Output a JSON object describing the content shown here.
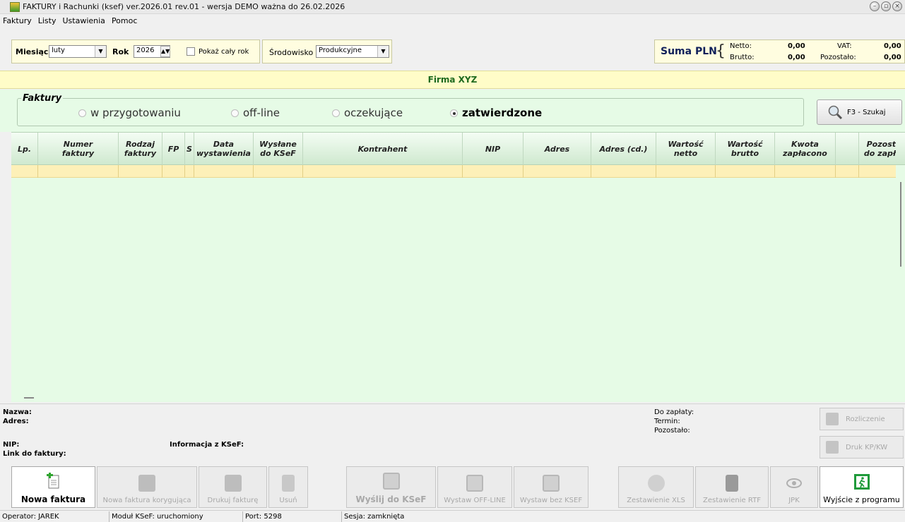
{
  "window": {
    "title": "FAKTURY i Rachunki (ksef) ver.2026.01 rev.01 - wersja DEMO ważna do 26.02.2026"
  },
  "menu": [
    "Faktury",
    "Listy",
    "Ustawienia",
    "Pomoc"
  ],
  "filters": {
    "month_label": "Miesiąc",
    "month_value": "luty",
    "year_label": "Rok",
    "year_value": "2026",
    "show_year_label": "Pokaż cały rok",
    "env_label": "Środowisko",
    "env_value": "Produkcyjne"
  },
  "summary": {
    "title": "Suma PLN",
    "netto_label": "Netto:",
    "netto_value": "0,00",
    "brutto_label": "Brutto:",
    "brutto_value": "0,00",
    "vat_label": "VAT:",
    "vat_value": "0,00",
    "remaining_label": "Pozostało:",
    "remaining_value": "0,00"
  },
  "firm": "Firma XYZ",
  "invoices_group": {
    "title": "Faktury",
    "options": [
      "w przygotowaniu",
      "off-line",
      "oczekujące",
      "zatwierdzone"
    ],
    "selected": "zatwierdzone"
  },
  "search_button": "F3 - Szukaj",
  "table": {
    "columns": [
      [
        "Lp."
      ],
      [
        "Numer",
        "faktury"
      ],
      [
        "Rodzaj",
        "faktury"
      ],
      [
        "FP"
      ],
      [
        "S"
      ],
      [
        "Data",
        "wystawienia"
      ],
      [
        "Wysłane",
        "do KSeF"
      ],
      [
        "Kontrahent"
      ],
      [
        "NIP"
      ],
      [
        "Adres"
      ],
      [
        "Adres (cd.)"
      ],
      [
        "Wartość",
        "netto"
      ],
      [
        "Wartość",
        "brutto"
      ],
      [
        "Kwota",
        "zapłacono"
      ],
      [
        ""
      ],
      [
        "Pozost",
        "do zapł"
      ]
    ]
  },
  "details": {
    "name_label": "Nazwa:",
    "address_label": "Adres:",
    "nip_label": "NIP:",
    "link_label": "Link do faktury:",
    "ksef_info_label": "Informacja z KSeF:",
    "to_pay_label": "Do zapłaty:",
    "term_label": "Termin:",
    "remaining_label": "Pozostało:",
    "settlement_button": "Rozliczenie",
    "print_kp_button": "Druk KP/KW"
  },
  "buttons": {
    "new_invoice": "Nowa faktura",
    "new_correction": "Nowa faktura korygująca",
    "print_invoice": "Drukuj fakturę",
    "delete": "Usuń",
    "send_ksef": "Wyślij do KSeF",
    "issue_offline": "Wystaw OFF-LINE",
    "issue_no_ksef": "Wystaw bez KSEF",
    "report_xls": "Zestawienie XLS",
    "report_rtf": "Zestawienie RTF",
    "jpk": "JPK",
    "exit": "Wyjście z programu"
  },
  "status": {
    "operator": "Operator: JAREK",
    "module": "Moduł KSeF: uruchomiony",
    "port": "Port: 5298",
    "session": "Sesja: zamknięta"
  }
}
